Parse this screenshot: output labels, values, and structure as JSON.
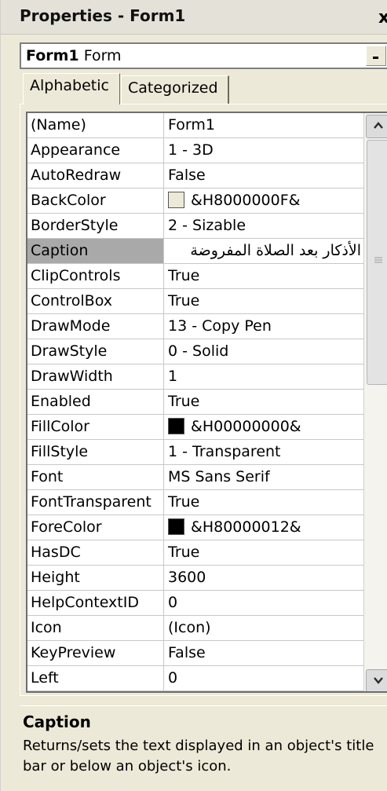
{
  "window": {
    "title": "Properties - Form1",
    "close_glyph": "x"
  },
  "object_selector": {
    "name": "Form1",
    "type": "Form"
  },
  "tabs": [
    {
      "label": "Alphabetic",
      "active": true
    },
    {
      "label": "Categorized",
      "active": false
    }
  ],
  "properties": [
    {
      "name": "(Name)",
      "value": "Form1"
    },
    {
      "name": "Appearance",
      "value": "1 - 3D"
    },
    {
      "name": "AutoRedraw",
      "value": "False"
    },
    {
      "name": "BackColor",
      "value": "&H8000000F&",
      "swatch": "#ece9d8"
    },
    {
      "name": "BorderStyle",
      "value": "2 - Sizable"
    },
    {
      "name": "Caption",
      "value": "الأذكار بعد الصلاة المفروضة",
      "selected": true
    },
    {
      "name": "ClipControls",
      "value": "True"
    },
    {
      "name": "ControlBox",
      "value": "True"
    },
    {
      "name": "DrawMode",
      "value": "13 - Copy Pen"
    },
    {
      "name": "DrawStyle",
      "value": "0 - Solid"
    },
    {
      "name": "DrawWidth",
      "value": "1"
    },
    {
      "name": "Enabled",
      "value": "True"
    },
    {
      "name": "FillColor",
      "value": "&H00000000&",
      "swatch": "#000000"
    },
    {
      "name": "FillStyle",
      "value": "1 - Transparent"
    },
    {
      "name": "Font",
      "value": "MS Sans Serif"
    },
    {
      "name": "FontTransparent",
      "value": "True"
    },
    {
      "name": "ForeColor",
      "value": "&H80000012&",
      "swatch": "#000000"
    },
    {
      "name": "HasDC",
      "value": "True"
    },
    {
      "name": "Height",
      "value": "3600"
    },
    {
      "name": "HelpContextID",
      "value": "0"
    },
    {
      "name": "Icon",
      "value": "(Icon)"
    },
    {
      "name": "KeyPreview",
      "value": "False"
    },
    {
      "name": "Left",
      "value": "0"
    }
  ],
  "description": {
    "title": "Caption",
    "text": "Returns/sets the text displayed in an object's title bar or below an object's icon."
  },
  "icons": {
    "scroll_up": "chevron-up-icon",
    "scroll_down": "chevron-down-icon",
    "thumb_grip": "grip-icon"
  },
  "colors": {
    "background": "#ece9d8",
    "selected_row": "#a9a9a9",
    "grid_line": "#c8c8c8"
  }
}
